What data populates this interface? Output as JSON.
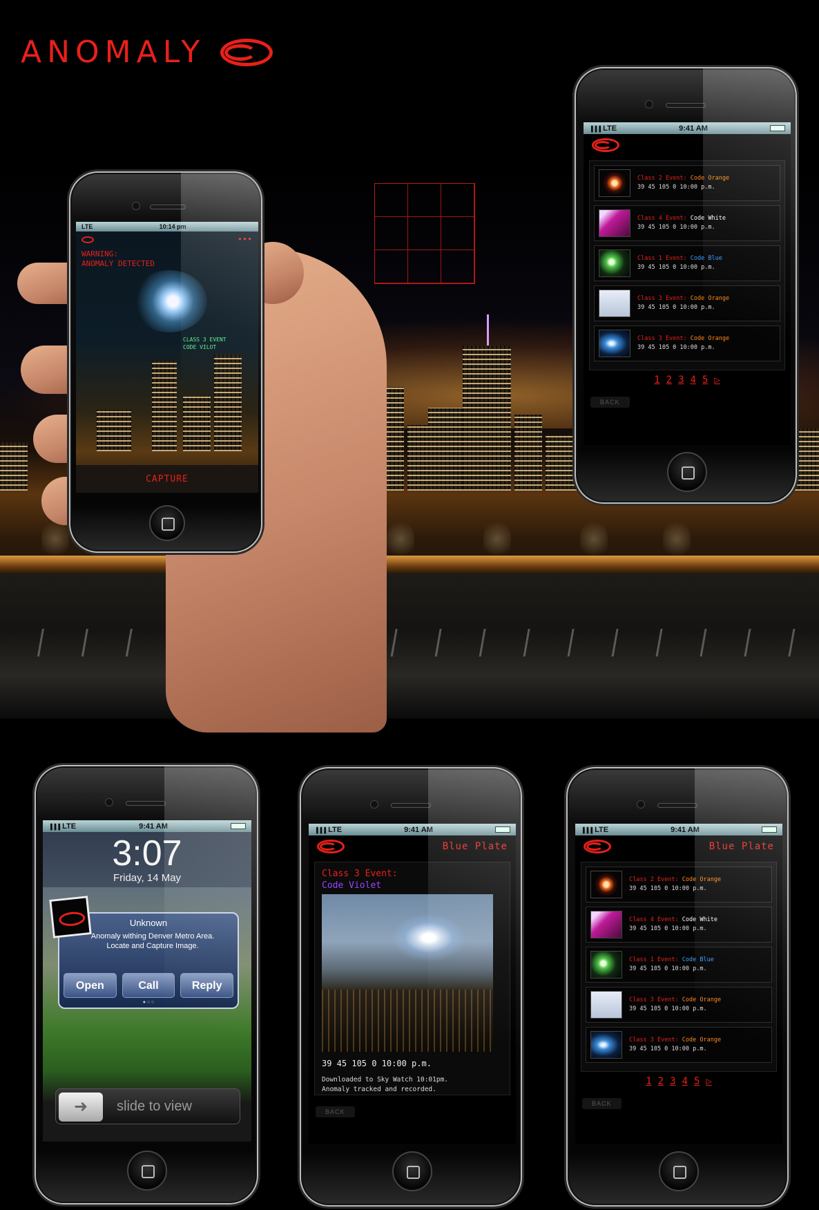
{
  "brand": {
    "name": "ANOMALY"
  },
  "status": {
    "carrier": "LTE",
    "time": "9:41 AM",
    "signal": "▐▐▐"
  },
  "camera_phone": {
    "status_carrier": "LTE",
    "status_time": "10:14 pm",
    "warning_line1": "WARNING:",
    "warning_line2": "ANOMALY DETECTED",
    "overlay_line1": "CLASS 3 EVENT",
    "overlay_line2": "CODE VILOT",
    "capture_label": "CAPTURE"
  },
  "events": [
    {
      "label": "Class 2 Event:",
      "code": "Code Orange",
      "code_color": "#ff8a1a",
      "coords": "39 45 105 0 10:00 p.m.",
      "thumb": "sun"
    },
    {
      "label": "Class 4 Event:",
      "code": "Code White",
      "code_color": "#ffffff",
      "coords": "39 45 105 0 10:00 p.m.",
      "thumb": "magenta"
    },
    {
      "label": "Class 1 Event:",
      "code": "Code Blue",
      "code_color": "#3aa0ff",
      "coords": "39 45 105 0 10:00 p.m.",
      "thumb": "green"
    },
    {
      "label": "Class 3 Event:",
      "code": "Code Orange",
      "code_color": "#ff8a1a",
      "coords": "39 45 105 0 10:00 p.m.",
      "thumb": "paper"
    },
    {
      "label": "Class 3 Event:",
      "code": "Code Orange",
      "code_color": "#ff8a1a",
      "coords": "39 45 105 0 10:00 p.m.",
      "thumb": "comet"
    }
  ],
  "pager": {
    "pages": [
      "1",
      "2",
      "3",
      "4",
      "5"
    ],
    "next": "▷"
  },
  "back_label": "BACK",
  "app_title": "Blue Plate",
  "lock": {
    "clock": "3:07",
    "date": "Friday, 14 May",
    "sender": "Unknown",
    "message": "Anomaly withing Denver Metro Area. Locate and Capture Image.",
    "open": "Open",
    "call": "Call",
    "reply": "Reply",
    "slide": "slide to view"
  },
  "detail": {
    "title_line1": "Class 3 Event:",
    "title_line2": "Code Violet",
    "coords": "39 45 105 0 10:00 p.m.",
    "note_line1": "Downloaded to Sky Watch 10:01pm.",
    "note_line2": "Anomaly tracked and recorded."
  },
  "colors": {
    "accent": "#e8201a",
    "violet": "#9a45ff",
    "lte_bar": "#8fb3b8"
  }
}
